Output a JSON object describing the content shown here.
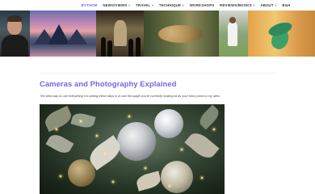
{
  "nav": {
    "items": [
      {
        "label": "BYTHOM",
        "active": true,
        "dropdown": false
      },
      {
        "label": "NEWS/VIEWS",
        "active": false,
        "dropdown": true
      },
      {
        "label": "TRAVEL",
        "active": false,
        "dropdown": true
      },
      {
        "label": "TECHNIQUE",
        "active": false,
        "dropdown": true
      },
      {
        "label": "WORKSHOPS",
        "active": false,
        "dropdown": false
      },
      {
        "label": "REVIEWS/BOOKS",
        "active": false,
        "dropdown": true
      },
      {
        "label": "ABOUT",
        "active": false,
        "dropdown": true
      },
      {
        "label": "B&H",
        "active": false,
        "dropdown": false
      }
    ],
    "dropdown_glyph": "˅"
  },
  "page": {
    "title": "Cameras and Photography Explained",
    "intro": "The best way to use everything I'm writing these days is to use this page you're currently looking at as your entry point to my sites."
  },
  "colors": {
    "accent": "#6b6be0",
    "nav_text": "#3a3a3a",
    "intro_text": "#444444"
  }
}
